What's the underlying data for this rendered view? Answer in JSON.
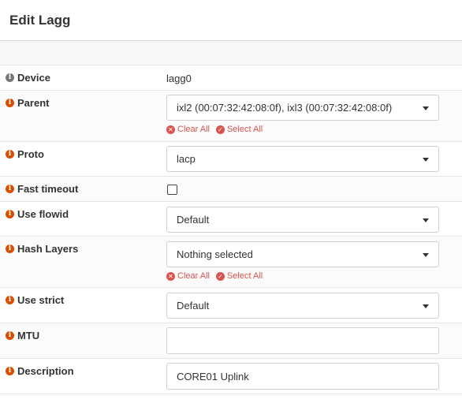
{
  "page": {
    "title": "Edit Lagg"
  },
  "colors": {
    "info_grey": "#777777",
    "info_orange": "#d94f00",
    "action_red": "#d9534f"
  },
  "fields": {
    "device": {
      "label": "Device",
      "value": "lagg0"
    },
    "parent": {
      "label": "Parent",
      "value": "ixl2 (00:07:32:42:08:0f), ixl3 (00:07:32:42:08:0f)",
      "clear_all": "Clear All",
      "select_all": "Select All"
    },
    "proto": {
      "label": "Proto",
      "value": "lacp"
    },
    "fast_timeout": {
      "label": "Fast timeout",
      "checked": false
    },
    "use_flowid": {
      "label": "Use flowid",
      "value": "Default"
    },
    "hash_layers": {
      "label": "Hash Layers",
      "value": "Nothing selected",
      "clear_all": "Clear All",
      "select_all": "Select All"
    },
    "use_strict": {
      "label": "Use strict",
      "value": "Default"
    },
    "mtu": {
      "label": "MTU",
      "value": ""
    },
    "description": {
      "label": "Description",
      "value": "CORE01 Uplink"
    }
  },
  "icons": {
    "info": "info-circle-icon",
    "clear": "times-circle-icon",
    "select": "check-circle-icon",
    "caret": "caret-down-icon"
  }
}
